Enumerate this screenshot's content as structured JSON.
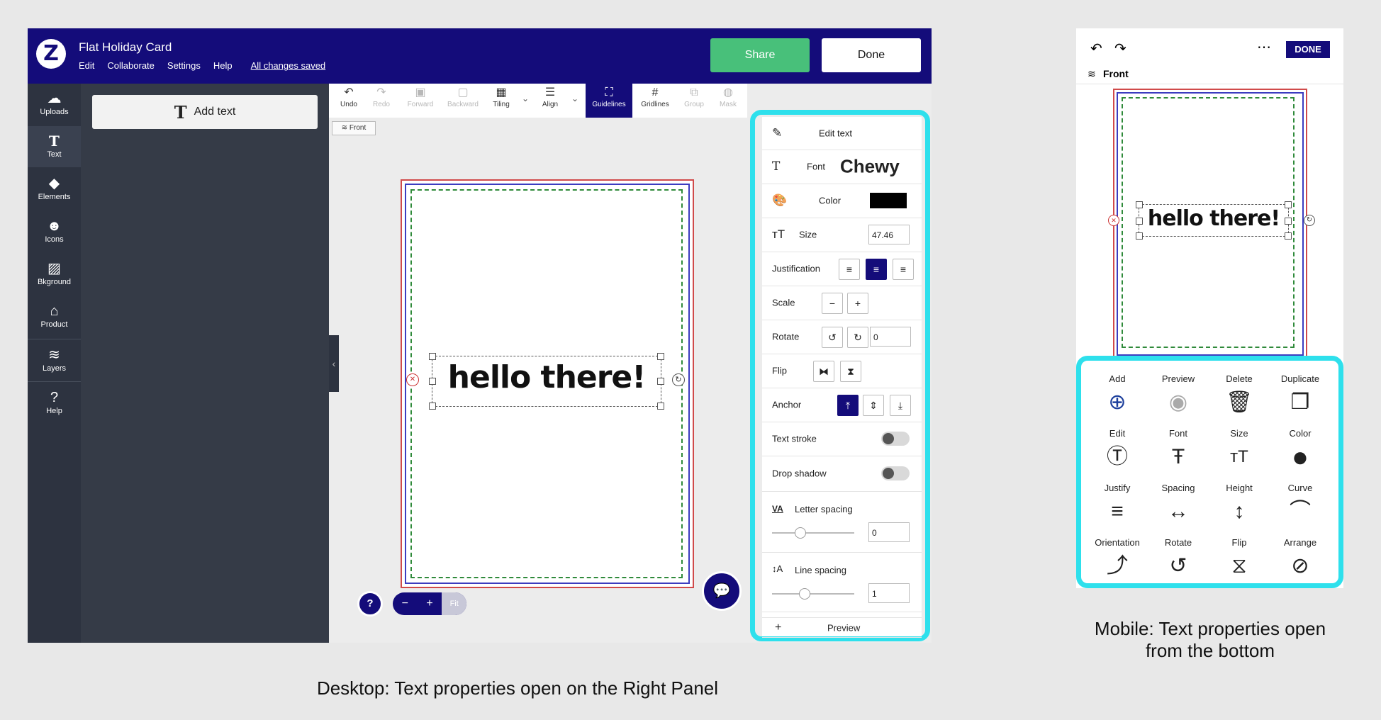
{
  "desktop": {
    "header": {
      "logo_letter": "Z",
      "title": "Flat Holiday Card",
      "menu": [
        "Edit",
        "Collaborate",
        "Settings",
        "Help"
      ],
      "saved_status": "All changes saved",
      "share_label": "Share",
      "done_label": "Done"
    },
    "rail": [
      {
        "label": "Uploads",
        "icon": "cloud-upload-icon",
        "glyph": "☁"
      },
      {
        "label": "Text",
        "icon": "text-icon",
        "glyph": "T"
      },
      {
        "label": "Elements",
        "icon": "elements-icon",
        "glyph": "◆"
      },
      {
        "label": "Icons",
        "icon": "smiley-icon",
        "glyph": "☻"
      },
      {
        "label": "Bkground",
        "icon": "background-icon",
        "glyph": "▨"
      },
      {
        "label": "Product",
        "icon": "product-icon",
        "glyph": "⌂"
      },
      {
        "label": "Layers",
        "icon": "layers-icon",
        "glyph": "≋"
      },
      {
        "label": "Help",
        "icon": "help-icon",
        "glyph": "?"
      }
    ],
    "add_text_label": "Add text",
    "toolbar": [
      {
        "label": "Undo",
        "glyph": "↶",
        "state": "normal"
      },
      {
        "label": "Redo",
        "glyph": "↷",
        "state": "disabled"
      },
      {
        "label": "Forward",
        "glyph": "▣",
        "state": "disabled"
      },
      {
        "label": "Backward",
        "glyph": "▢",
        "state": "disabled"
      },
      {
        "label": "Tiling",
        "glyph": "▦",
        "state": "normal"
      },
      {
        "label": "Align",
        "glyph": "☰",
        "state": "normal"
      },
      {
        "label": "Guidelines",
        "glyph": "⛶",
        "state": "active"
      },
      {
        "label": "Gridlines",
        "glyph": "#",
        "state": "normal"
      },
      {
        "label": "Group",
        "glyph": "⧉",
        "state": "disabled"
      },
      {
        "label": "Mask",
        "glyph": "◍",
        "state": "disabled"
      }
    ],
    "side_tag": "Front",
    "card_text": "hello there!",
    "zoom": {
      "minus": "−",
      "plus": "+",
      "fit": "Fit"
    },
    "help_glyph": "?",
    "right_panel": {
      "edit_text": "Edit text",
      "font_label": "Font",
      "font_value": "Chewy",
      "color_label": "Color",
      "color_value": "#000000",
      "size_label": "Size",
      "size_value": "47.46",
      "justification_label": "Justification",
      "scale_label": "Scale",
      "rotate_label": "Rotate",
      "rotate_value": "0",
      "flip_label": "Flip",
      "anchor_label": "Anchor",
      "text_stroke_label": "Text stroke",
      "drop_shadow_label": "Drop shadow",
      "letter_spacing_label": "Letter spacing",
      "letter_spacing_value": "0",
      "line_spacing_label": "Line spacing",
      "line_spacing_value": "1",
      "preview_label": "Preview"
    },
    "caption": "Desktop: Text properties open on the Right Panel"
  },
  "mobile": {
    "done_label": "DONE",
    "side_label": "Front",
    "card_text": "hello there!",
    "tools": [
      {
        "label": "Add",
        "icon": "add-circle-icon",
        "glyph": "⊕"
      },
      {
        "label": "Preview",
        "icon": "preview-icon",
        "glyph": "◉"
      },
      {
        "label": "Delete",
        "icon": "trash-icon",
        "glyph": "🗑"
      },
      {
        "label": "Duplicate",
        "icon": "duplicate-icon",
        "glyph": "❐"
      },
      {
        "label": "Edit",
        "icon": "edit-text-icon",
        "glyph": "Ⓣ"
      },
      {
        "label": "Font",
        "icon": "font-icon",
        "glyph": "Ŧ"
      },
      {
        "label": "Size",
        "icon": "size-icon",
        "glyph": "ᴛT"
      },
      {
        "label": "Color",
        "icon": "color-dot-icon",
        "glyph": "●"
      },
      {
        "label": "Justify",
        "icon": "justify-icon",
        "glyph": "≡"
      },
      {
        "label": "Spacing",
        "icon": "spacing-icon",
        "glyph": "↔"
      },
      {
        "label": "Height",
        "icon": "height-icon",
        "glyph": "↕"
      },
      {
        "label": "Curve",
        "icon": "curve-icon",
        "glyph": "⌒"
      },
      {
        "label": "Orientation",
        "icon": "orientation-icon",
        "glyph": "⤴"
      },
      {
        "label": "Rotate",
        "icon": "rotate-icon",
        "glyph": "↺"
      },
      {
        "label": "Flip",
        "icon": "flip-icon",
        "glyph": "⧖"
      },
      {
        "label": "Arrange",
        "icon": "arrange-icon",
        "glyph": "⊘"
      }
    ],
    "caption_line1": "Mobile: Text properties open",
    "caption_line2": "from the bottom"
  }
}
